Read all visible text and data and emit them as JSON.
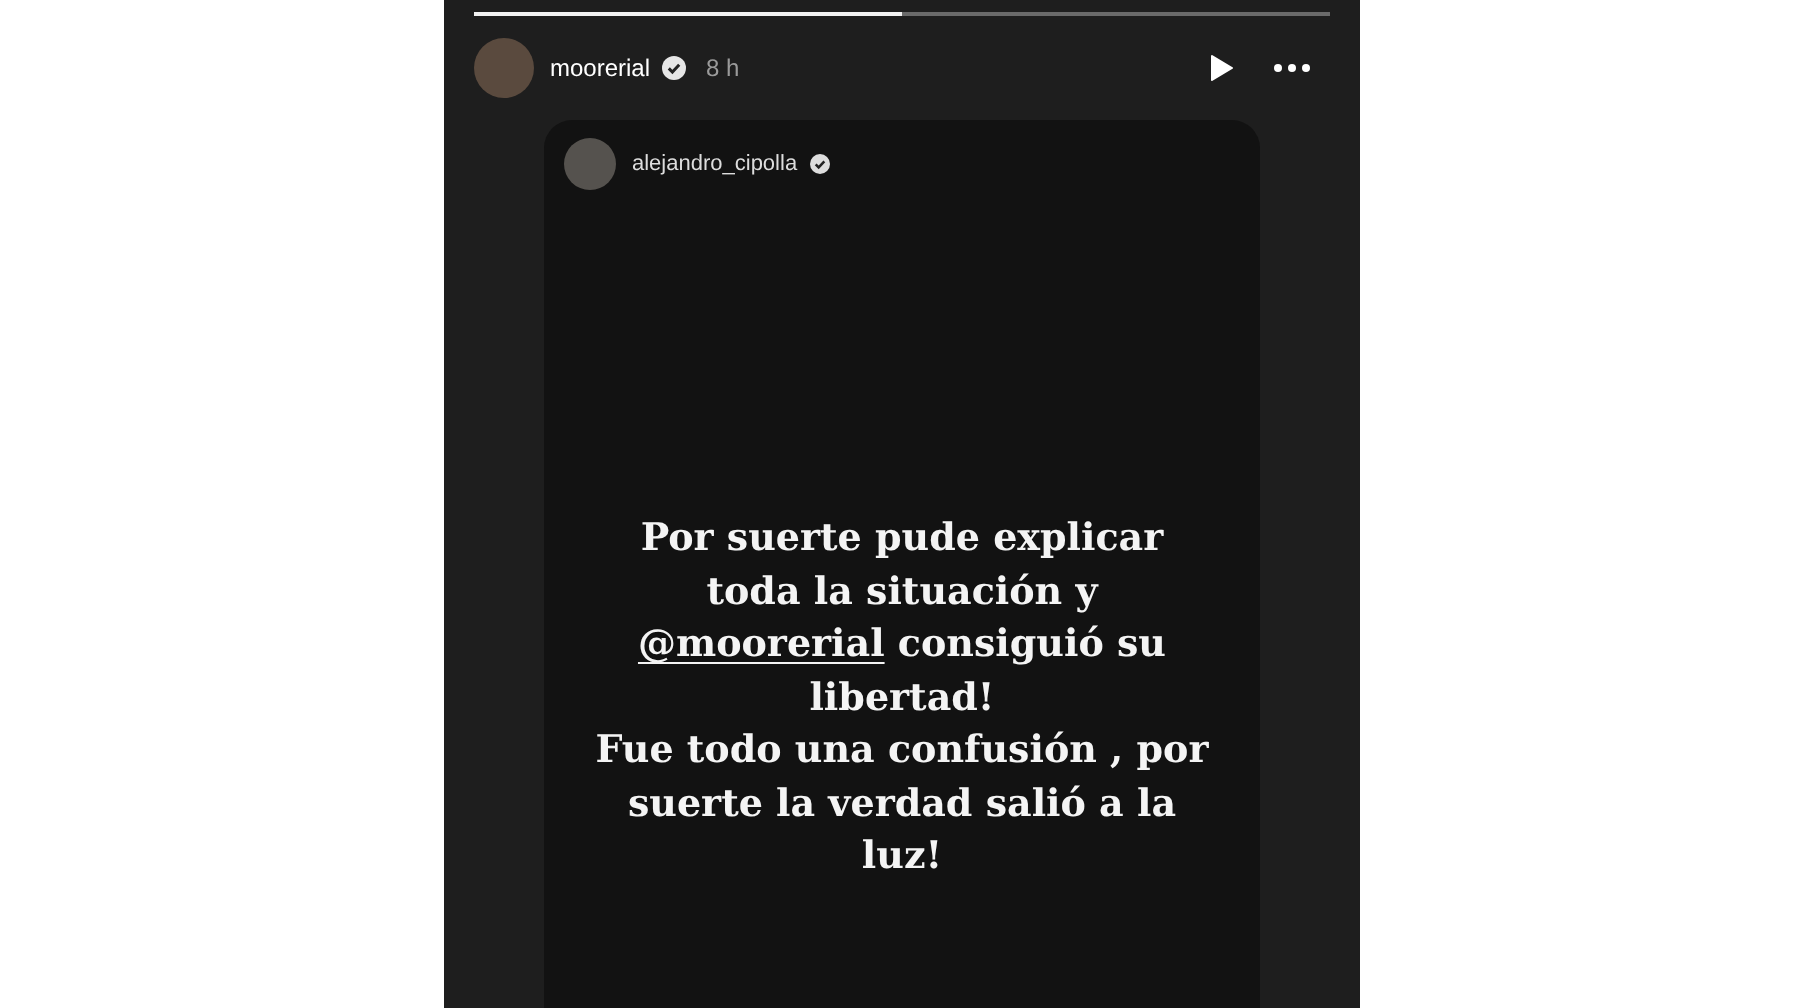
{
  "story": {
    "progress": {
      "level": 0.5
    },
    "header": {
      "username": "moorerial",
      "verified": true,
      "time": "8 h"
    },
    "shared_post": {
      "username": "alejandro_cipolla",
      "verified": true,
      "lines": [
        [
          {
            "kind": "text",
            "text": "Por suerte pude explicar"
          }
        ],
        [
          {
            "kind": "text",
            "text": "toda la situación y"
          }
        ],
        [
          {
            "kind": "mention",
            "text": "@moorerial"
          },
          {
            "kind": "text",
            "text": " consiguió su"
          }
        ],
        [
          {
            "kind": "text",
            "text": "libertad!"
          }
        ],
        [
          {
            "kind": "text",
            "text": "Fue todo una confusión , por"
          }
        ],
        [
          {
            "kind": "text",
            "text": "suerte la verdad salió a la"
          }
        ],
        [
          {
            "kind": "text",
            "text": "luz!"
          }
        ]
      ]
    }
  }
}
